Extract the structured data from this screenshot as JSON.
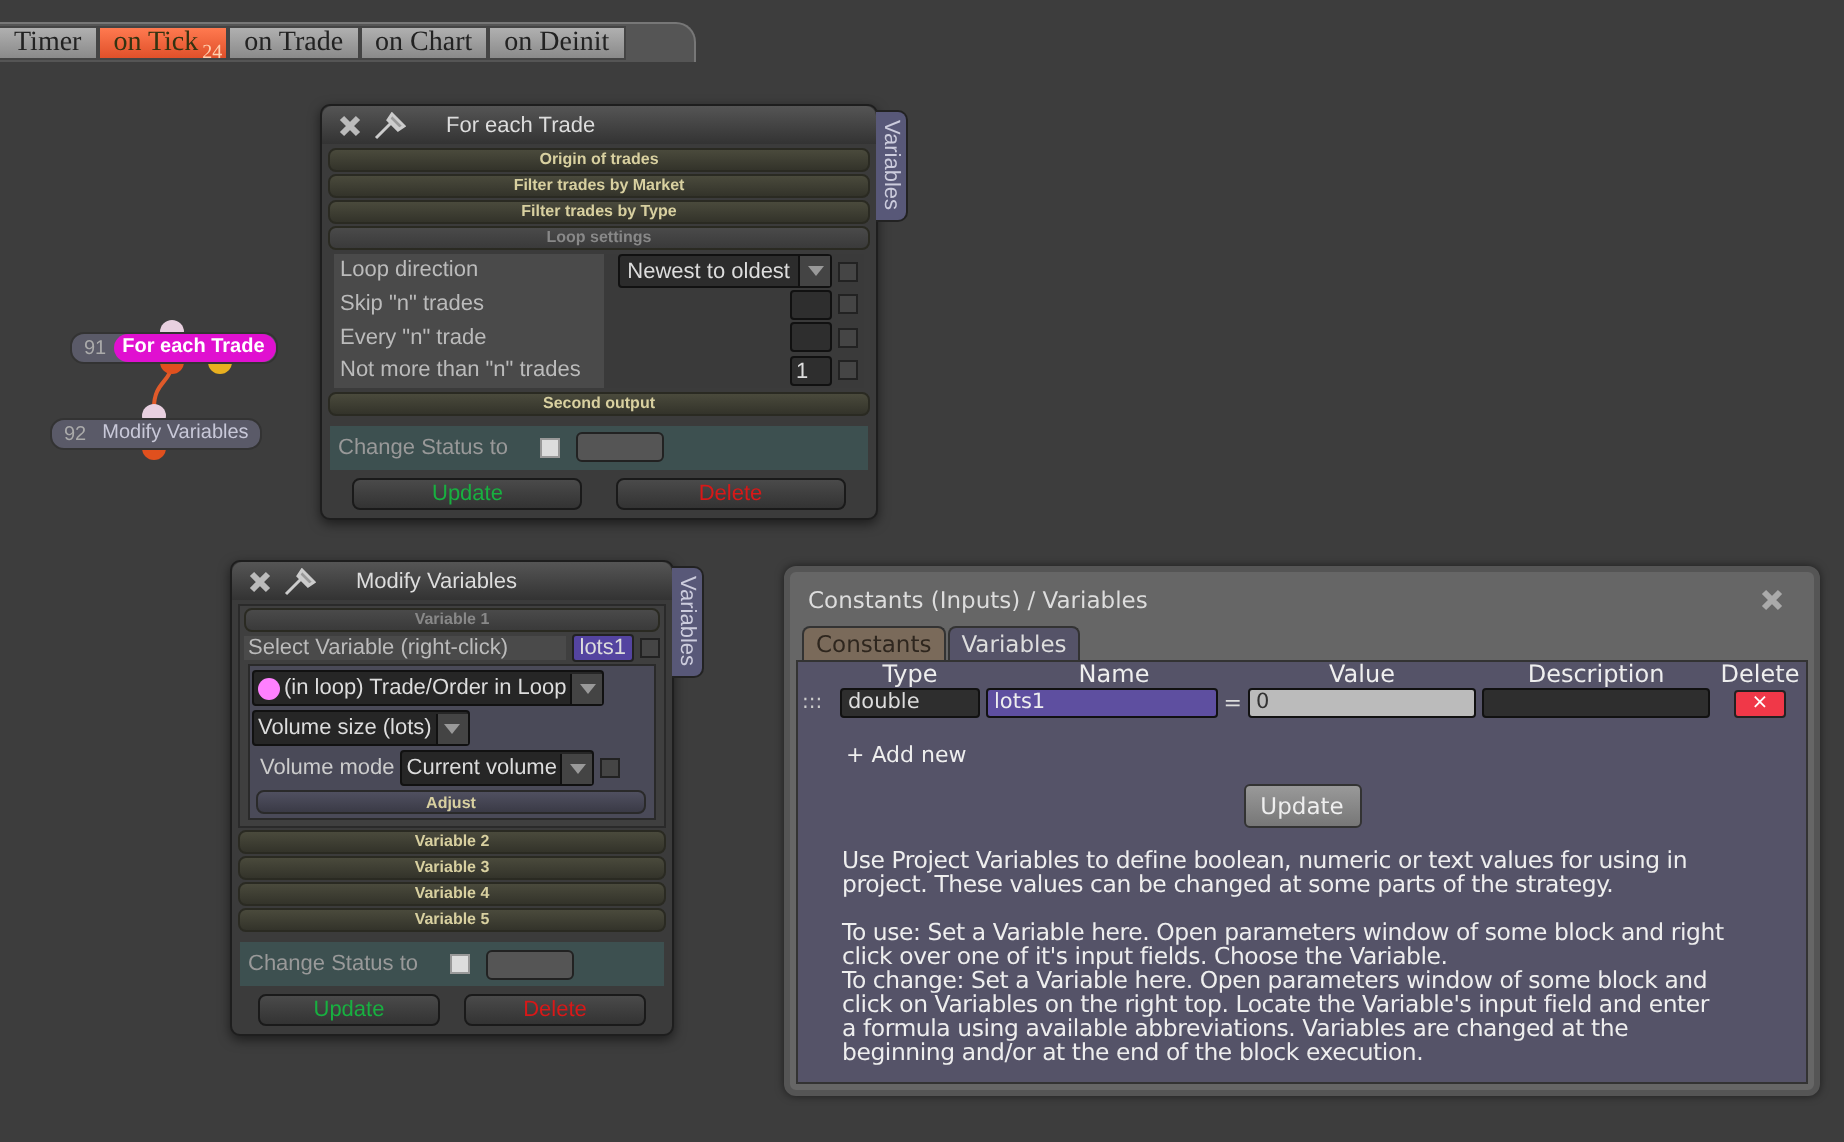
{
  "tabs": [
    {
      "label": "Timer",
      "selected": false
    },
    {
      "label": "on Tick",
      "selected": true,
      "badge": "24"
    },
    {
      "label": "on Trade",
      "selected": false
    },
    {
      "label": "on Chart",
      "selected": false
    },
    {
      "label": "on Deinit",
      "selected": false
    }
  ],
  "nodes": [
    {
      "number": "91",
      "label": "For each Trade",
      "selected": true
    },
    {
      "number": "92",
      "label": "Modify Variables",
      "selected": false
    }
  ],
  "for_each_window": {
    "title": "For each Trade",
    "side_tab": "Variables",
    "sections": [
      "Origin of trades",
      "Filter trades by Market",
      "Filter trades by Type"
    ],
    "loop_section": "Loop settings",
    "params": [
      {
        "label": "Loop direction",
        "kind": "dropdown",
        "value": "Newest to oldest",
        "checked": false
      },
      {
        "label": "Skip \"n\" trades",
        "kind": "input",
        "checked": false
      },
      {
        "label": "Every \"n\" trade",
        "kind": "input",
        "checked": false
      },
      {
        "label": "Not more than \"n\" trades",
        "kind": "input",
        "value": "1",
        "checked": false
      }
    ],
    "second_section": "Second output",
    "status_label": "Change Status to",
    "status_checked": false,
    "buttons": [
      {
        "label": "Update",
        "kind": "confirm"
      },
      {
        "label": "Delete",
        "kind": "danger"
      }
    ]
  },
  "modify_window": {
    "title": "Modify Variables",
    "side_tab": "Variables",
    "variable": {
      "header": "Variable 1",
      "select_label": "Select Variable (right-click)",
      "chip": "lots1",
      "chip_checked": false,
      "source": "(in loop) Trade/Order in Loop",
      "property": "Volume size (lots)",
      "mode_label": "Volume mode",
      "mode_value": "Current volume",
      "mode_checked": false,
      "adjust": "Adjust"
    },
    "sections": [
      "Variable 2",
      "Variable 3",
      "Variable 4",
      "Variable 5"
    ],
    "status_label": "Change Status to",
    "status_checked": false,
    "buttons": [
      {
        "label": "Update",
        "kind": "confirm"
      },
      {
        "label": "Delete",
        "kind": "danger"
      }
    ]
  },
  "variables_window": {
    "title": "Constants (Inputs) / Variables",
    "tabs": [
      {
        "label": "Constants",
        "selected": false
      },
      {
        "label": "Variables",
        "selected": true
      }
    ],
    "columns": [
      "Type",
      "Name",
      "Value",
      "Description",
      "Delete"
    ],
    "rows": [
      {
        "handle": ":::",
        "type": "double",
        "name": "lots1",
        "equals": "=",
        "value": "0",
        "delete": "×"
      }
    ],
    "add_new": "+ Add new",
    "update": "Update",
    "help": [
      "Use Project Variables to define boolean, numeric or text values for using in project. These values can be changed at some parts of the strategy.",
      "To use: Set a Variable here. Open parameters window of some block and right click over one of it's input fields. Choose the Variable.",
      "To change: Set a Variable here. Open parameters window of some block and click on Variables on the right top. Locate the Variable's input field and enter a formula using available abbreviations. Variables are changed at the beginning and/or at the end of the block execution."
    ]
  }
}
